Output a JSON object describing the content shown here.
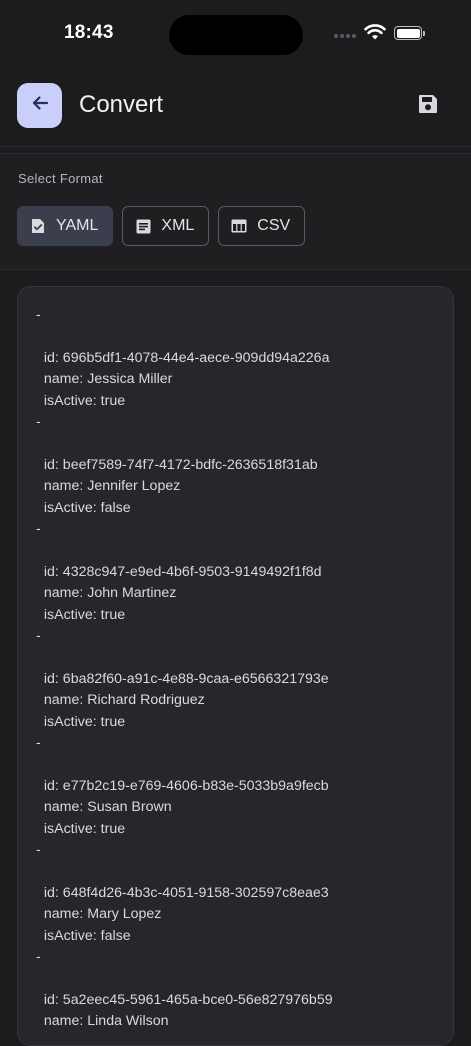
{
  "status_bar": {
    "time": "18:43"
  },
  "app_bar": {
    "title": "Convert",
    "back_icon": "arrow-left-icon",
    "save_icon": "floppy-disk-icon"
  },
  "format": {
    "label": "Select Format",
    "options": [
      {
        "label": "YAML",
        "icon": "file-check-icon",
        "selected": true
      },
      {
        "label": "XML",
        "icon": "document-lines-icon",
        "selected": false
      },
      {
        "label": "CSV",
        "icon": "table-icon",
        "selected": false
      }
    ]
  },
  "output": {
    "text": "-\n\n  id: 696b5df1-4078-44e4-aece-909dd94a226a\n  name: Jessica Miller\n  isActive: true\n-\n\n  id: beef7589-74f7-4172-bdfc-2636518f31ab\n  name: Jennifer Lopez\n  isActive: false\n-\n\n  id: 4328c947-e9ed-4b6f-9503-9149492f1f8d\n  name: John Martinez\n  isActive: true\n-\n\n  id: 6ba82f60-a91c-4e88-9caa-e6566321793e\n  name: Richard Rodriguez\n  isActive: true\n-\n\n  id: e77b2c19-e769-4606-b83e-5033b9a9fecb\n  name: Susan Brown\n  isActive: true\n-\n\n  id: 648f4d26-4b3c-4051-9158-302597c8eae3\n  name: Mary Lopez\n  isActive: false\n-\n\n  id: 5a2eec45-5961-465a-bce0-56e827976b59\n  name: Linda Wilson"
  },
  "colors": {
    "accent": "#c9cff9",
    "background": "#1c1c1e",
    "selected_chip": "#3b3f4d"
  }
}
